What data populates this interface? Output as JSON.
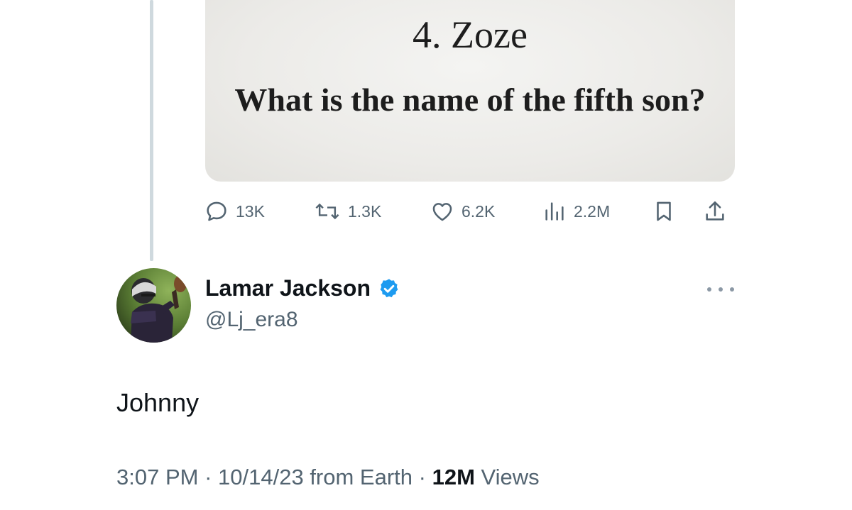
{
  "quoted_media": {
    "line1": "4. Zoze",
    "line2": "What is the name of the fifth son?"
  },
  "actions": {
    "replies": "13K",
    "reposts": "1.3K",
    "likes": "6.2K",
    "views": "2.2M"
  },
  "author": {
    "display_name": "Lamar Jackson",
    "handle": "@Lj_era8",
    "verified": true
  },
  "tweet": {
    "text": "Johnny",
    "time": "3:07 PM",
    "date": "10/14/23",
    "source": "from Earth",
    "views_count": "12M",
    "views_label": "Views"
  },
  "colors": {
    "text_primary": "#0f1419",
    "text_secondary": "#536471",
    "verified_badge": "#1d9bf0",
    "thread_line": "#cfd9de"
  },
  "icons": {
    "reply": "reply-icon",
    "repost": "repost-icon",
    "like": "heart-icon",
    "views": "analytics-icon",
    "bookmark": "bookmark-icon",
    "share": "share-icon",
    "more": "more-dots-icon",
    "verified": "verified-badge-icon"
  }
}
